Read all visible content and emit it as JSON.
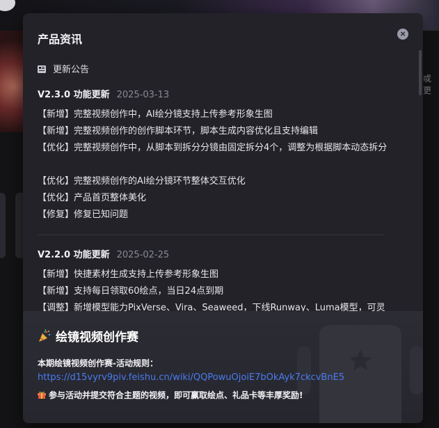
{
  "background": {
    "right_text": "戓更"
  },
  "modal": {
    "title": "产品资讯",
    "close_icon": "×",
    "section_title": "更新公告",
    "versions": [
      {
        "title": "V2.3.0 功能更新",
        "date": "2025-03-13",
        "items": [
          "【新增】完整视频创作中，AI绘分镜支持上传参考形象生图",
          "【新增】完整视频创作的创作脚本环节，脚本生成内容优化且支持编辑",
          "【优化】完整视频创作中，从脚本到拆分分镜由固定拆分4个，调整为根据脚本动态拆分",
          "【优化】完整视频创作的AI绘分镜环节整体交互优化",
          "【优化】产品首页整体美化",
          "【修复】修复已知问题"
        ]
      },
      {
        "title": "V2.2.0 功能更新",
        "date": "2025-02-25",
        "items": [
          "【新增】快捷素材生成支持上传参考形象生图",
          "【新增】支持每日领取60绘点，当日24点到期",
          "【调整】新增模型能力PixVerse、Vira、Seaweed，下线Runway、Luma模型，可灵"
        ]
      }
    ]
  },
  "banner": {
    "title": "绘镜视频创作赛",
    "rule_label": "本期绘镜视频创作赛-活动规则：",
    "link": "https://d15vyrv9piv.feishu.cn/wiki/QQPowuOjoiE7bOkAyk7ckcvBnE5",
    "note": "参与活动并提交符合主题的视频，即可赢取绘点、礼品卡等丰厚奖励!"
  }
}
